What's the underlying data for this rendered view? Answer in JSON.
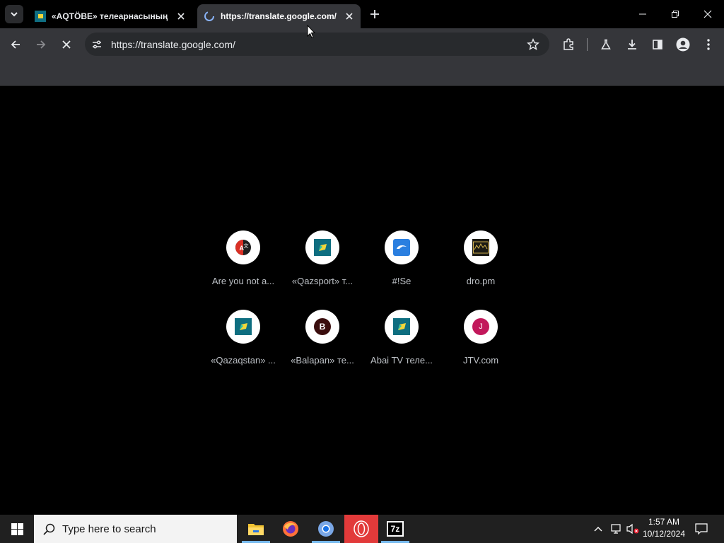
{
  "browser": {
    "tabs": [
      {
        "title": "«AQTÖBE» телеарнасының ре",
        "active": false,
        "icon": "aqtobe-favicon"
      },
      {
        "title": "https://translate.google.com/",
        "active": true,
        "icon": "loading-globe-icon"
      }
    ],
    "address_bar": {
      "url": "https://translate.google.com/"
    },
    "toolbar_icons": [
      "back-icon",
      "forward-icon",
      "loading-spinner-icon",
      "site-info-icon",
      "bookmark-star-icon",
      "extensions-icon",
      "labs-icon",
      "download-icon",
      "side-panel-icon",
      "profile-icon",
      "menu-icon"
    ]
  },
  "shortcuts": [
    {
      "label": "Are you not a...",
      "icon": "google-translate-icon"
    },
    {
      "label": "«Qazsport» т...",
      "icon": "qazsport-icon"
    },
    {
      "label": "#!Se",
      "icon": "blue-swirl-icon"
    },
    {
      "label": "dro.pm",
      "icon": "dro-icon"
    },
    {
      "label": "«Qazaqstan» ...",
      "icon": "qazaqstan-icon"
    },
    {
      "label": "«Balapan» те...",
      "icon": "letter-b-icon",
      "letter": "B"
    },
    {
      "label": "Abai TV теле...",
      "icon": "abai-tv-icon"
    },
    {
      "label": "JTV.com",
      "icon": "letter-j-icon",
      "letter": "J"
    }
  ],
  "taskbar": {
    "search_placeholder": "Type here to search",
    "time": "1:57 AM",
    "date": "10/12/2024",
    "apps": [
      "file-explorer-icon",
      "firefox-icon",
      "chrome-icon",
      "opera-icon",
      "7zip-icon"
    ],
    "app_7z_label": "7z"
  },
  "colors": {
    "page_bg": "#000000",
    "toolbar_bg": "#35363a",
    "taskbar_bg": "#202020",
    "accent_blue": "#4c8df6"
  }
}
